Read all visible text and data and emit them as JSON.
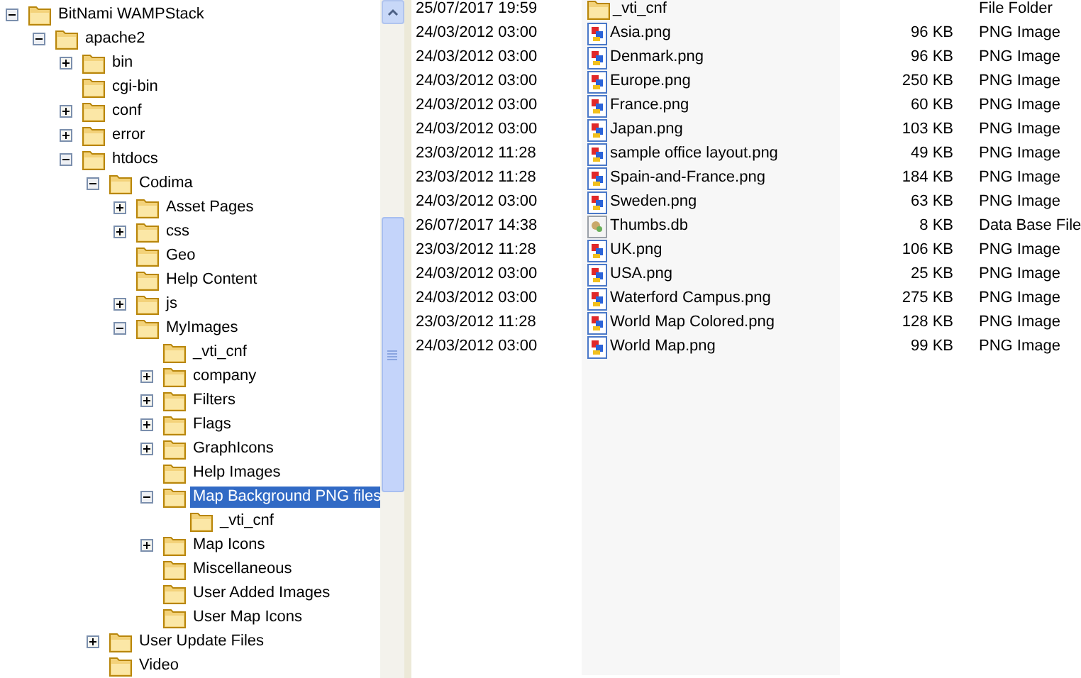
{
  "tree": [
    {
      "label": "BitNami WAMPStack",
      "expanded": true,
      "selected": false,
      "children": [
        {
          "label": "apache2",
          "expanded": true,
          "selected": false,
          "children": [
            {
              "label": "bin",
              "expanded": false,
              "selected": false
            },
            {
              "label": "cgi-bin",
              "selected": false
            },
            {
              "label": "conf",
              "expanded": false,
              "selected": false
            },
            {
              "label": "error",
              "expanded": false,
              "selected": false
            },
            {
              "label": "htdocs",
              "expanded": true,
              "selected": false,
              "children": [
                {
                  "label": "Codima",
                  "expanded": true,
                  "selected": false,
                  "children": [
                    {
                      "label": "Asset Pages",
                      "expanded": false,
                      "selected": false
                    },
                    {
                      "label": "css",
                      "expanded": false,
                      "selected": false
                    },
                    {
                      "label": "Geo",
                      "selected": false
                    },
                    {
                      "label": "Help Content",
                      "selected": false
                    },
                    {
                      "label": "js",
                      "expanded": false,
                      "selected": false
                    },
                    {
                      "label": "MyImages",
                      "expanded": true,
                      "selected": false,
                      "children": [
                        {
                          "label": "_vti_cnf",
                          "selected": false
                        },
                        {
                          "label": "company",
                          "expanded": false,
                          "selected": false
                        },
                        {
                          "label": "Filters",
                          "expanded": false,
                          "selected": false
                        },
                        {
                          "label": "Flags",
                          "expanded": false,
                          "selected": false
                        },
                        {
                          "label": "GraphIcons",
                          "expanded": false,
                          "selected": false
                        },
                        {
                          "label": "Help Images",
                          "selected": false
                        },
                        {
                          "label": "Map Background PNG files",
                          "expanded": true,
                          "selected": true,
                          "children": [
                            {
                              "label": "_vti_cnf",
                              "selected": false
                            }
                          ]
                        },
                        {
                          "label": "Map Icons",
                          "expanded": false,
                          "selected": false
                        },
                        {
                          "label": "Miscellaneous",
                          "selected": false
                        },
                        {
                          "label": "User Added Images",
                          "selected": false
                        },
                        {
                          "label": "User Map Icons",
                          "selected": false
                        }
                      ]
                    }
                  ]
                },
                {
                  "label": "User Update Files",
                  "expanded": false,
                  "selected": false
                },
                {
                  "label": "Video",
                  "selected": false
                }
              ]
            }
          ]
        }
      ]
    }
  ],
  "files": [
    {
      "kind": "folder",
      "date": "25/07/2017 19:59",
      "name": "_vti_cnf",
      "type": "File Folder"
    },
    {
      "kind": "image",
      "date": "24/03/2012 03:00",
      "name": "Asia.png",
      "size": "96 KB",
      "type": "PNG Image"
    },
    {
      "kind": "image",
      "date": "24/03/2012 03:00",
      "name": "Denmark.png",
      "size": "96 KB",
      "type": "PNG Image"
    },
    {
      "kind": "image",
      "date": "24/03/2012 03:00",
      "name": "Europe.png",
      "size": "250 KB",
      "type": "PNG Image"
    },
    {
      "kind": "image",
      "date": "24/03/2012 03:00",
      "name": "France.png",
      "size": "60 KB",
      "type": "PNG Image"
    },
    {
      "kind": "image",
      "date": "24/03/2012 03:00",
      "name": "Japan.png",
      "size": "103 KB",
      "type": "PNG Image"
    },
    {
      "kind": "image",
      "date": "23/03/2012 11:28",
      "name": "sample office layout.png",
      "size": "49 KB",
      "type": "PNG Image"
    },
    {
      "kind": "image",
      "date": "23/03/2012 11:28",
      "name": "Spain-and-France.png",
      "size": "184 KB",
      "type": "PNG Image"
    },
    {
      "kind": "image",
      "date": "24/03/2012 03:00",
      "name": "Sweden.png",
      "size": "63 KB",
      "type": "PNG Image"
    },
    {
      "kind": "database",
      "date": "26/07/2017 14:38",
      "name": "Thumbs.db",
      "size": "8 KB",
      "type": "Data Base File"
    },
    {
      "kind": "image",
      "date": "23/03/2012 11:28",
      "name": "UK.png",
      "size": "106 KB",
      "type": "PNG Image"
    },
    {
      "kind": "image",
      "date": "24/03/2012 03:00",
      "name": "USA.png",
      "size": "25 KB",
      "type": "PNG Image"
    },
    {
      "kind": "image",
      "date": "24/03/2012 03:00",
      "name": "Waterford Campus.png",
      "size": "275 KB",
      "type": "PNG Image"
    },
    {
      "kind": "image",
      "date": "23/03/2012 11:28",
      "name": "World Map Colored.png",
      "size": "128 KB",
      "type": "PNG Image"
    },
    {
      "kind": "image",
      "date": "24/03/2012 03:00",
      "name": "World Map.png",
      "size": "99 KB",
      "type": "PNG Image"
    }
  ]
}
